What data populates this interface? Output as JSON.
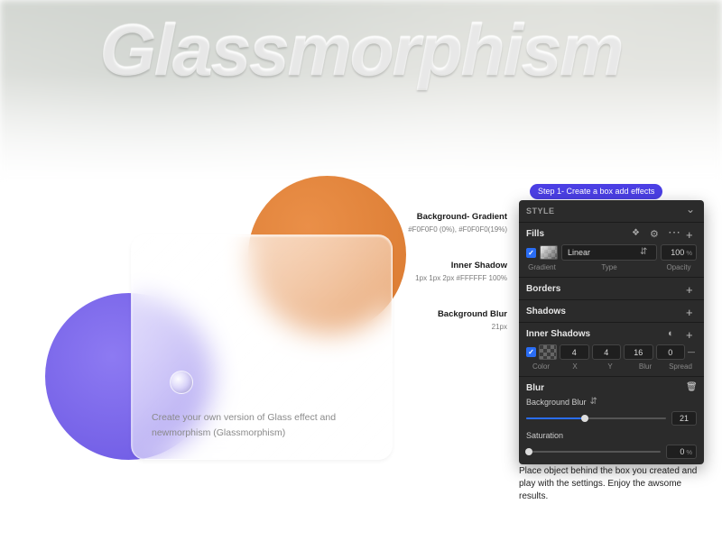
{
  "title": "Glassmorphism",
  "card_text": "Create your own version of Glass effect and newmorphism (Glassmorphism)",
  "annotations": {
    "gradient": {
      "label": "Background- Gradient",
      "value": "#F0F0F0 (0%), #F0F0F0(19%)"
    },
    "inner_shadow": {
      "label": "Inner Shadow",
      "value": "1px 1px 2px #FFFFFF 100%"
    },
    "bg_blur": {
      "label": "Background Blur",
      "value": "21px"
    }
  },
  "step_badge": "Step 1- Create a box add effects",
  "panel": {
    "header": "STYLE",
    "fills": {
      "title": "Fills",
      "type": "Linear",
      "opacity": "100",
      "sub": {
        "a": "Gradient",
        "b": "Type",
        "c": "Opacity"
      }
    },
    "borders": "Borders",
    "shadows": "Shadows",
    "inner_shadows": {
      "title": "Inner Shadows",
      "x": "4",
      "y": "4",
      "blur": "16",
      "spread": "0",
      "labels": {
        "color": "Color",
        "x": "X",
        "y": "Y",
        "blur": "Blur",
        "spread": "Spread"
      }
    },
    "blur": {
      "title": "Blur",
      "mode": "Background Blur",
      "value": "21",
      "sat_label": "Saturation",
      "sat_value": "0"
    }
  },
  "caption": "Place object behind the box you created and play with the settings. Enjoy the awsome results."
}
